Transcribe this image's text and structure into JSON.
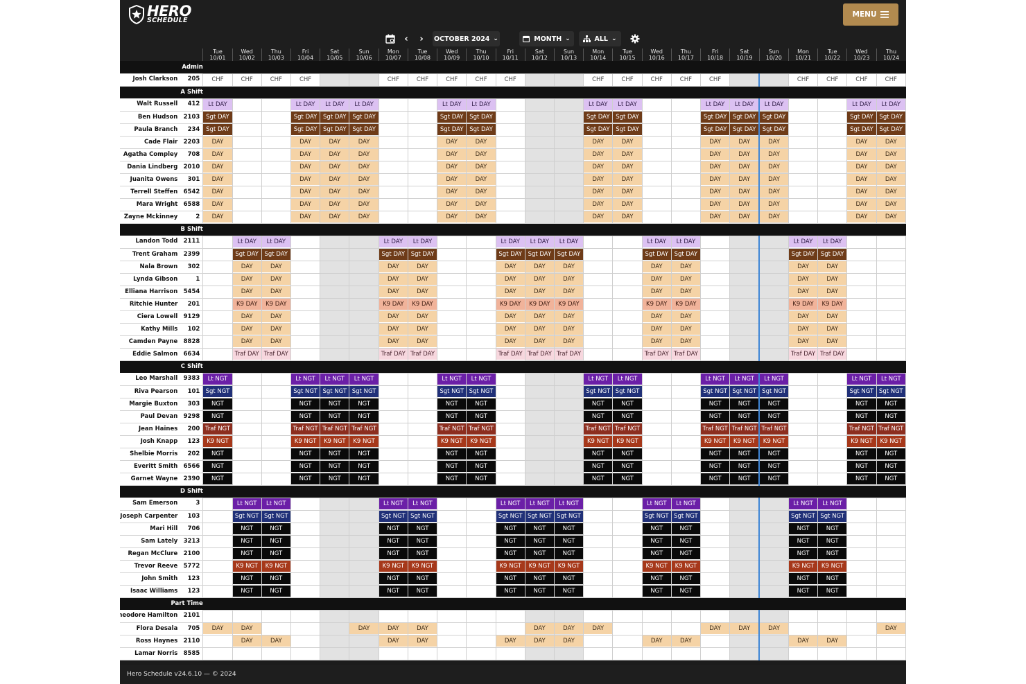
{
  "app": {
    "logo_line1": "HERO",
    "logo_line2": "SCHEDULE",
    "menu_label": "MENU",
    "month_label": "OCTOBER 2024",
    "view_label": "MONTH",
    "filter_label": "ALL",
    "footer_text": "Hero Schedule v24.6.10 — © 2024"
  },
  "colors": {
    "accent": "#b28a4f",
    "header_bg": "#1e1e1e",
    "lt_day": "#dcc1f2",
    "sgt_day": "#6e3b18",
    "day": "#f5d3a6",
    "k9_day": "#f1b39a",
    "traf_day": "#f7d7de",
    "lt_ngt": "#6b1fa7",
    "sgt_ngt": "#203078",
    "ngt": "#0a0a0a",
    "traf_ngt": "#8c2e1f",
    "k9_ngt": "#a6381a",
    "today_line": "#3f86d6"
  },
  "days": [
    {
      "dow": "Tue",
      "date": "10/01"
    },
    {
      "dow": "Wed",
      "date": "10/02"
    },
    {
      "dow": "Thu",
      "date": "10/03"
    },
    {
      "dow": "Fri",
      "date": "10/04"
    },
    {
      "dow": "Sat",
      "date": "10/05"
    },
    {
      "dow": "Sun",
      "date": "10/06"
    },
    {
      "dow": "Mon",
      "date": "10/07"
    },
    {
      "dow": "Tue",
      "date": "10/08"
    },
    {
      "dow": "Wed",
      "date": "10/09"
    },
    {
      "dow": "Thu",
      "date": "10/10"
    },
    {
      "dow": "Fri",
      "date": "10/11"
    },
    {
      "dow": "Sat",
      "date": "10/12"
    },
    {
      "dow": "Sun",
      "date": "10/13"
    },
    {
      "dow": "Mon",
      "date": "10/14"
    },
    {
      "dow": "Tue",
      "date": "10/15"
    },
    {
      "dow": "Wed",
      "date": "10/16"
    },
    {
      "dow": "Thu",
      "date": "10/17"
    },
    {
      "dow": "Fri",
      "date": "10/18"
    },
    {
      "dow": "Sat",
      "date": "10/19"
    },
    {
      "dow": "Sun",
      "date": "10/20"
    },
    {
      "dow": "Mon",
      "date": "10/21"
    },
    {
      "dow": "Tue",
      "date": "10/22"
    },
    {
      "dow": "Wed",
      "date": "10/23"
    },
    {
      "dow": "Thu",
      "date": "10/24"
    }
  ],
  "sections": [
    {
      "name": "Admin",
      "rows": [
        {
          "name": "Josh Clarkson",
          "badge": "205",
          "pattern": "chf"
        }
      ]
    },
    {
      "name": "A Shift",
      "rows": [
        {
          "name": "Walt Russell",
          "badge": "412",
          "pattern": "A",
          "code": "Lt DAY"
        },
        {
          "name": "Ben Hudson",
          "badge": "2103",
          "pattern": "A",
          "code": "Sgt DAY"
        },
        {
          "name": "Paula Branch",
          "badge": "234",
          "pattern": "A",
          "code": "Sgt DAY"
        },
        {
          "name": "Cade Flair",
          "badge": "2203",
          "pattern": "A",
          "code": "DAY"
        },
        {
          "name": "Agatha Compley",
          "badge": "708",
          "pattern": "A",
          "code": "DAY"
        },
        {
          "name": "Dania Lindberg",
          "badge": "2010",
          "pattern": "A",
          "code": "DAY"
        },
        {
          "name": "Juanita Owens",
          "badge": "301",
          "pattern": "A",
          "code": "DAY"
        },
        {
          "name": "Terrell Steffen",
          "badge": "6542",
          "pattern": "A",
          "code": "DAY"
        },
        {
          "name": "Mara Wright",
          "badge": "6588",
          "pattern": "A",
          "code": "DAY"
        },
        {
          "name": "Zayne Mckinney",
          "badge": "2",
          "pattern": "A",
          "code": "DAY"
        }
      ]
    },
    {
      "name": "B Shift",
      "rows": [
        {
          "name": "Landon Todd",
          "badge": "2111",
          "pattern": "B",
          "code": "Lt DAY"
        },
        {
          "name": "Trent Graham",
          "badge": "2399",
          "pattern": "B",
          "code": "Sgt DAY"
        },
        {
          "name": "Nala Brown",
          "badge": "302",
          "pattern": "B",
          "code": "DAY"
        },
        {
          "name": "Lynda Gibson",
          "badge": "1",
          "pattern": "B",
          "code": "DAY"
        },
        {
          "name": "Elliana Harrison",
          "badge": "5454",
          "pattern": "B",
          "code": "DAY"
        },
        {
          "name": "Ritchie Hunter",
          "badge": "201",
          "pattern": "B",
          "code": "K9 DAY"
        },
        {
          "name": "Ciera Lowell",
          "badge": "9129",
          "pattern": "B",
          "code": "DAY"
        },
        {
          "name": "Kathy Mills",
          "badge": "102",
          "pattern": "B",
          "code": "DAY"
        },
        {
          "name": "Camden Payne",
          "badge": "8828",
          "pattern": "B",
          "code": "DAY"
        },
        {
          "name": "Eddie Salmon",
          "badge": "6634",
          "pattern": "B",
          "code": "Traf DAY"
        }
      ]
    },
    {
      "name": "C Shift",
      "rows": [
        {
          "name": "Leo Marshall",
          "badge": "9383",
          "pattern": "A",
          "code": "Lt NGT"
        },
        {
          "name": "Riva Pearson",
          "badge": "101",
          "pattern": "A",
          "code": "Sgt NGT"
        },
        {
          "name": "Margie Buxton",
          "badge": "303",
          "pattern": "A",
          "code": "NGT"
        },
        {
          "name": "Paul Devan",
          "badge": "9298",
          "pattern": "A",
          "code": "NGT"
        },
        {
          "name": "Jean Haines",
          "badge": "200",
          "pattern": "A",
          "code": "Traf NGT"
        },
        {
          "name": "Josh Knapp",
          "badge": "123",
          "pattern": "A",
          "code": "K9 NGT"
        },
        {
          "name": "Shelbie Morris",
          "badge": "202",
          "pattern": "A",
          "code": "NGT"
        },
        {
          "name": "Everitt Smith",
          "badge": "6566",
          "pattern": "A",
          "code": "NGT"
        },
        {
          "name": "Garnet Wayne",
          "badge": "2390",
          "pattern": "A",
          "code": "NGT"
        }
      ]
    },
    {
      "name": "D Shift",
      "rows": [
        {
          "name": "Sam Emerson",
          "badge": "3",
          "pattern": "B",
          "code": "Lt NGT"
        },
        {
          "name": "Joseph Carpenter",
          "badge": "103",
          "pattern": "B",
          "code": "Sgt NGT"
        },
        {
          "name": "Mari Hill",
          "badge": "706",
          "pattern": "B",
          "code": "NGT"
        },
        {
          "name": "Sam Lately",
          "badge": "3213",
          "pattern": "B",
          "code": "NGT"
        },
        {
          "name": "Regan McClure",
          "badge": "2100",
          "pattern": "B",
          "code": "NGT"
        },
        {
          "name": "Trevor Reeve",
          "badge": "5772",
          "pattern": "B",
          "code": "K9 NGT"
        },
        {
          "name": "John Smith",
          "badge": "123",
          "pattern": "B",
          "code": "NGT"
        },
        {
          "name": "Isaac Williams",
          "badge": "123",
          "pattern": "B",
          "code": "NGT"
        }
      ]
    },
    {
      "name": "Part Time",
      "rows": [
        {
          "name": "Theodore Hamilton",
          "badge": "2101",
          "pattern": "custom",
          "days_on": [],
          "code": "DAY"
        },
        {
          "name": "Flora Desala",
          "badge": "705",
          "pattern": "custom",
          "days_on": [
            0,
            1,
            5,
            6,
            7,
            11,
            12,
            13,
            17,
            18,
            19,
            23
          ],
          "code": "DAY"
        },
        {
          "name": "Ross Haynes",
          "badge": "2110",
          "pattern": "custom",
          "days_on": [
            1,
            2,
            6,
            7,
            10,
            11,
            12,
            15,
            16,
            20,
            21
          ],
          "code": "DAY"
        },
        {
          "name": "Lamar Norris",
          "badge": "8585",
          "pattern": "custom",
          "days_on": [],
          "code": "DAY"
        }
      ]
    }
  ],
  "patterns": {
    "A_days_on": [
      0,
      3,
      4,
      5,
      8,
      9,
      13,
      14,
      17,
      18,
      19,
      22,
      23
    ],
    "B_days_on": [
      1,
      2,
      6,
      7,
      10,
      11,
      12,
      15,
      16,
      20,
      21
    ],
    "chf_days_on": [
      0,
      1,
      2,
      3,
      6,
      7,
      8,
      9,
      10,
      13,
      14,
      15,
      16,
      17,
      20,
      21,
      22,
      23
    ],
    "chf_code": "CHF",
    "weekend_cols": [
      4,
      5,
      11,
      12,
      18,
      19
    ],
    "today_col": 18
  }
}
